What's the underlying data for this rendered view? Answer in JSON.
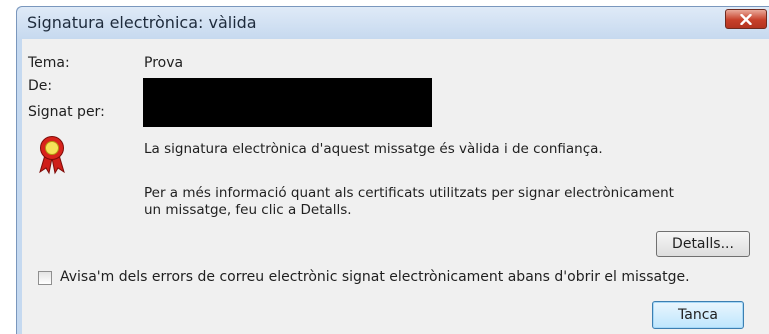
{
  "dialog": {
    "title": "Signatura electrònica: vàlida",
    "close_label": "✕"
  },
  "fields": {
    "subject_label": "Tema:",
    "subject_value": "Prova",
    "from_label": "De:",
    "signed_by_label": "Signat per:"
  },
  "status": {
    "icon": "award-ribbon-icon",
    "message": "La signatura electrònica d'aquest missatge és vàlida i de confiança.",
    "info": "Per a més informació quant als certificats utilitzats per signar electrònicament un missatge, feu clic a Detalls."
  },
  "buttons": {
    "details": "Detalls...",
    "close": "Tanca"
  },
  "warn_checkbox": {
    "label": "Avisa'm dels errors de correu electrònic signat electrònicament abans d'obrir el missatge.",
    "checked": false
  },
  "colors": {
    "title_bar": "#c6d9ef",
    "close_button": "#c7402a",
    "dialog_background": "#f0f0f0",
    "award_icon": "#d6201b"
  }
}
